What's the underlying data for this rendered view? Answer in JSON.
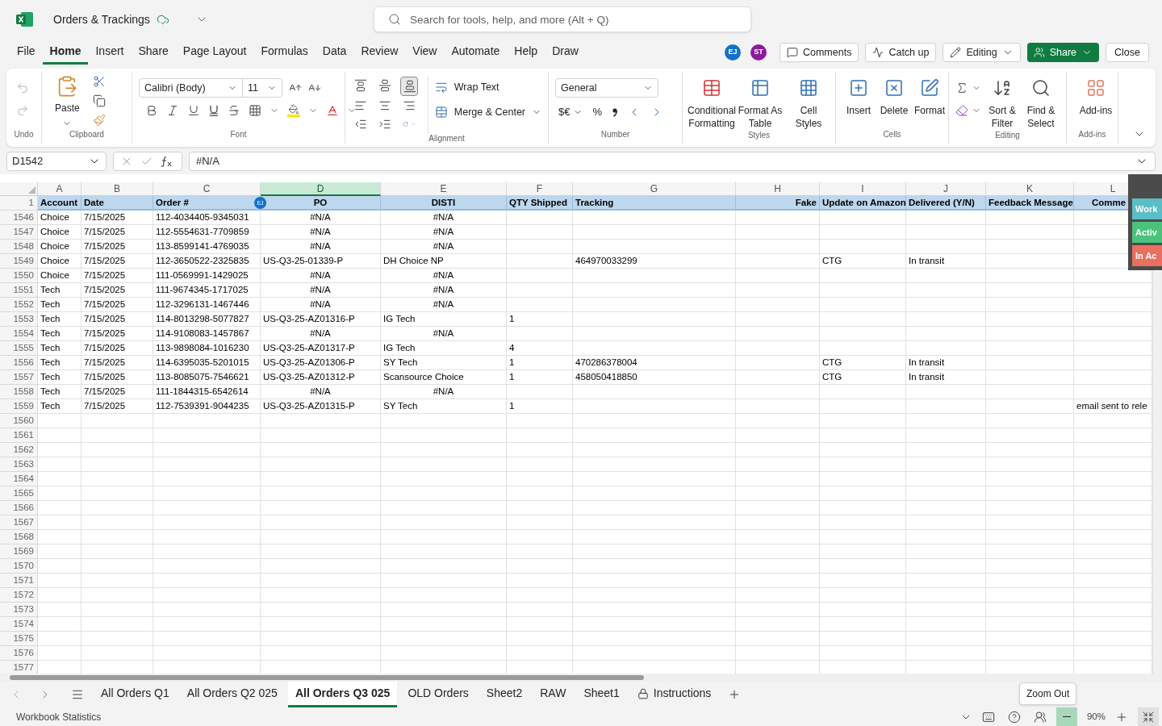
{
  "title_bar": {
    "file_name": "Orders & Trackings",
    "search_placeholder": "Search for tools, help, and more (Alt + Q)"
  },
  "menu_tabs": [
    {
      "label": "File",
      "selected": false
    },
    {
      "label": "Home",
      "selected": true
    },
    {
      "label": "Insert",
      "selected": false
    },
    {
      "label": "Share",
      "selected": false
    },
    {
      "label": "Page Layout",
      "selected": false
    },
    {
      "label": "Formulas",
      "selected": false
    },
    {
      "label": "Data",
      "selected": false
    },
    {
      "label": "Review",
      "selected": false
    },
    {
      "label": "View",
      "selected": false
    },
    {
      "label": "Automate",
      "selected": false
    },
    {
      "label": "Help",
      "selected": false
    },
    {
      "label": "Draw",
      "selected": false
    }
  ],
  "collaborators": [
    {
      "initials": "EJ",
      "color": "#1570c9"
    },
    {
      "initials": "ST",
      "color": "#8a1c9b"
    }
  ],
  "header_buttons": {
    "comments": "Comments",
    "catch_up": "Catch up",
    "editing": "Editing",
    "share": "Share",
    "close": "Close"
  },
  "ribbon": {
    "undo": {
      "label": "Undo"
    },
    "clipboard": {
      "label": "Clipboard",
      "paste": "Paste"
    },
    "font": {
      "label": "Font",
      "font_name": "Calibri (Body)",
      "font_size": "11"
    },
    "alignment": {
      "label": "Alignment",
      "wrap_text": "Wrap Text",
      "merge": "Merge & Center",
      "bottom_align_selected": true
    },
    "number": {
      "label": "Number",
      "format": "General",
      "currency": "$€",
      "percent": "%"
    },
    "styles": {
      "label": "Styles",
      "items": [
        "Conditional Formatting",
        "Format As Table",
        "Cell Styles"
      ]
    },
    "cells": {
      "label": "Cells",
      "items": [
        "Insert",
        "Delete",
        "Format"
      ]
    },
    "editing": {
      "label": "Editing",
      "items": [
        "Sort & Filter",
        "Find & Select"
      ]
    },
    "addins": {
      "label": "Add-ins",
      "items": [
        "Add-ins"
      ]
    }
  },
  "formula_bar": {
    "name_box": "D1542",
    "formula": "#N/A"
  },
  "sheet": {
    "columns": [
      {
        "letter": "A",
        "selected": false
      },
      {
        "letter": "B",
        "selected": false
      },
      {
        "letter": "C",
        "selected": false
      },
      {
        "letter": "D",
        "selected": true
      },
      {
        "letter": "E",
        "selected": false
      },
      {
        "letter": "F",
        "selected": false
      },
      {
        "letter": "G",
        "selected": false
      },
      {
        "letter": "H",
        "selected": false
      },
      {
        "letter": "I",
        "selected": false
      },
      {
        "letter": "J",
        "selected": false
      },
      {
        "letter": "K",
        "selected": false
      },
      {
        "letter": "L",
        "selected": false
      }
    ],
    "header_row": {
      "number": "1",
      "cells": [
        "Account",
        "Date",
        "Order #",
        "PO",
        "DISTI",
        "QTY Shipped",
        "Tracking",
        "Fake",
        "Update on Amazon",
        "Delivered (Y/N)",
        "Feedback Message",
        "Comme"
      ]
    },
    "presence_marker": {
      "initials": "EJ",
      "color": "#1570c9"
    },
    "rows": [
      {
        "number": "1546",
        "cells": {
          "A": {
            "text": "Choice"
          },
          "B": {
            "text": "7/15/2025"
          },
          "C": {
            "text": "112-4034405-9345031"
          },
          "D": {
            "text": "#N/A",
            "kind": "error"
          },
          "E": {
            "text": "#N/A",
            "kind": "error"
          }
        }
      },
      {
        "number": "1547",
        "cells": {
          "A": {
            "text": "Choice"
          },
          "B": {
            "text": "7/15/2025"
          },
          "C": {
            "text": "112-5554631-7709859"
          },
          "D": {
            "text": "#N/A",
            "kind": "error"
          },
          "E": {
            "text": "#N/A",
            "kind": "error"
          }
        }
      },
      {
        "number": "1548",
        "cells": {
          "A": {
            "text": "Choice"
          },
          "B": {
            "text": "7/15/2025"
          },
          "C": {
            "text": "113-8599141-4769035"
          },
          "D": {
            "text": "#N/A",
            "kind": "error"
          },
          "E": {
            "text": "#N/A",
            "kind": "error"
          }
        }
      },
      {
        "number": "1549",
        "cells": {
          "A": {
            "text": "Choice"
          },
          "B": {
            "text": "7/15/2025"
          },
          "C": {
            "text": "112-3650522-2325835"
          },
          "D": {
            "text": "US-Q3-25-01339-P"
          },
          "E": {
            "text": "DH Choice NP"
          },
          "G": {
            "text": "464970033299"
          },
          "I": {
            "text": "CTG"
          },
          "J": {
            "text": "In transit"
          }
        }
      },
      {
        "number": "1550",
        "cells": {
          "A": {
            "text": "Choice"
          },
          "B": {
            "text": "7/15/2025"
          },
          "C": {
            "text": "111-0569991-1429025"
          },
          "D": {
            "text": "#N/A",
            "kind": "error"
          },
          "E": {
            "text": "#N/A",
            "kind": "error"
          }
        }
      },
      {
        "number": "1551",
        "cells": {
          "A": {
            "text": "Tech"
          },
          "B": {
            "text": "7/15/2025"
          },
          "C": {
            "text": "111-9674345-1717025"
          },
          "D": {
            "text": "#N/A",
            "kind": "error"
          },
          "E": {
            "text": "#N/A",
            "kind": "error"
          }
        }
      },
      {
        "number": "1552",
        "cells": {
          "A": {
            "text": "Tech"
          },
          "B": {
            "text": "7/15/2025"
          },
          "C": {
            "text": "112-3296131-1467446"
          },
          "D": {
            "text": "#N/A",
            "kind": "error"
          },
          "E": {
            "text": "#N/A",
            "kind": "error"
          }
        }
      },
      {
        "number": "1553",
        "cells": {
          "A": {
            "text": "Tech"
          },
          "B": {
            "text": "7/15/2025"
          },
          "C": {
            "text": "114-8013298-5077827"
          },
          "D": {
            "text": "US-Q3-25-AZ01316-P"
          },
          "E": {
            "text": "IG Tech"
          },
          "F": {
            "text": "1"
          }
        }
      },
      {
        "number": "1554",
        "cells": {
          "A": {
            "text": "Tech"
          },
          "B": {
            "text": "7/15/2025"
          },
          "C": {
            "text": "114-9108083-1457867"
          },
          "D": {
            "text": "#N/A",
            "kind": "error"
          },
          "E": {
            "text": "#N/A",
            "kind": "error"
          }
        }
      },
      {
        "number": "1555",
        "cells": {
          "A": {
            "text": "Tech"
          },
          "B": {
            "text": "7/15/2025"
          },
          "C": {
            "text": "113-9898084-1016230"
          },
          "D": {
            "text": "US-Q3-25-AZ01317-P"
          },
          "E": {
            "text": "IG Tech"
          },
          "F": {
            "text": "4"
          }
        }
      },
      {
        "number": "1556",
        "cells": {
          "A": {
            "text": "Tech"
          },
          "B": {
            "text": "7/15/2025"
          },
          "C": {
            "text": "114-6395035-5201015"
          },
          "D": {
            "text": "US-Q3-25-AZ01306-P"
          },
          "E": {
            "text": "SY Tech"
          },
          "F": {
            "text": "1"
          },
          "G": {
            "text": "470286378004"
          },
          "I": {
            "text": "CTG"
          },
          "J": {
            "text": "In transit"
          }
        }
      },
      {
        "number": "1557",
        "cells": {
          "A": {
            "text": "Tech"
          },
          "B": {
            "text": "7/15/2025"
          },
          "C": {
            "text": "113-8085075-7546621"
          },
          "D": {
            "text": "US-Q3-25-AZ01312-P"
          },
          "E": {
            "text": "Scansource Choice"
          },
          "F": {
            "text": "1"
          },
          "G": {
            "text": "458050418850"
          },
          "I": {
            "text": "CTG"
          },
          "J": {
            "text": "In transit"
          }
        }
      },
      {
        "number": "1558",
        "cells": {
          "A": {
            "text": "Tech"
          },
          "B": {
            "text": "7/15/2025"
          },
          "C": {
            "text": "111-1844315-6542614"
          },
          "D": {
            "text": "#N/A",
            "kind": "error"
          },
          "E": {
            "text": "#N/A",
            "kind": "error"
          }
        }
      },
      {
        "number": "1559",
        "cells": {
          "A": {
            "text": "Tech"
          },
          "B": {
            "text": "7/15/2025"
          },
          "C": {
            "text": "112-7539391-9044235"
          },
          "D": {
            "text": "US-Q3-25-AZ01315-P"
          },
          "E": {
            "text": "SY Tech"
          },
          "F": {
            "text": "1"
          },
          "L": {
            "text": "email sent to rele"
          }
        }
      },
      {
        "number": "1560"
      },
      {
        "number": "1561"
      },
      {
        "number": "1562"
      },
      {
        "number": "1563"
      },
      {
        "number": "1564"
      },
      {
        "number": "1565"
      },
      {
        "number": "1566"
      },
      {
        "number": "1567"
      },
      {
        "number": "1568"
      },
      {
        "number": "1569"
      },
      {
        "number": "1570"
      },
      {
        "number": "1571"
      },
      {
        "number": "1572"
      },
      {
        "number": "1573"
      },
      {
        "number": "1574"
      },
      {
        "number": "1575"
      },
      {
        "number": "1576"
      },
      {
        "number": "1577"
      }
    ]
  },
  "side_panel": [
    {
      "label": "Work",
      "color": "#5bbec6"
    },
    {
      "label": "Activ",
      "color": "#4bc27b"
    },
    {
      "label": "In Ac",
      "color": "#e8705e"
    }
  ],
  "sheet_tabs": [
    {
      "label": "All Orders Q1",
      "selected": false,
      "kind": "plain"
    },
    {
      "label": "All Orders Q2 025",
      "selected": false,
      "kind": "plain"
    },
    {
      "label": "All Orders Q3 025",
      "selected": true,
      "kind": "plain"
    },
    {
      "label": "OLD Orders",
      "selected": false,
      "kind": "plain"
    },
    {
      "label": "Sheet2",
      "selected": false,
      "kind": "plain"
    },
    {
      "label": "RAW",
      "selected": false,
      "kind": "plain"
    },
    {
      "label": "Sheet1",
      "selected": false,
      "kind": "plain"
    },
    {
      "label": "Instructions",
      "selected": false,
      "kind": "locked"
    }
  ],
  "status_bar": {
    "left": "Workbook Statistics",
    "zoom": "90%",
    "tooltip": "Zoom Out"
  }
}
